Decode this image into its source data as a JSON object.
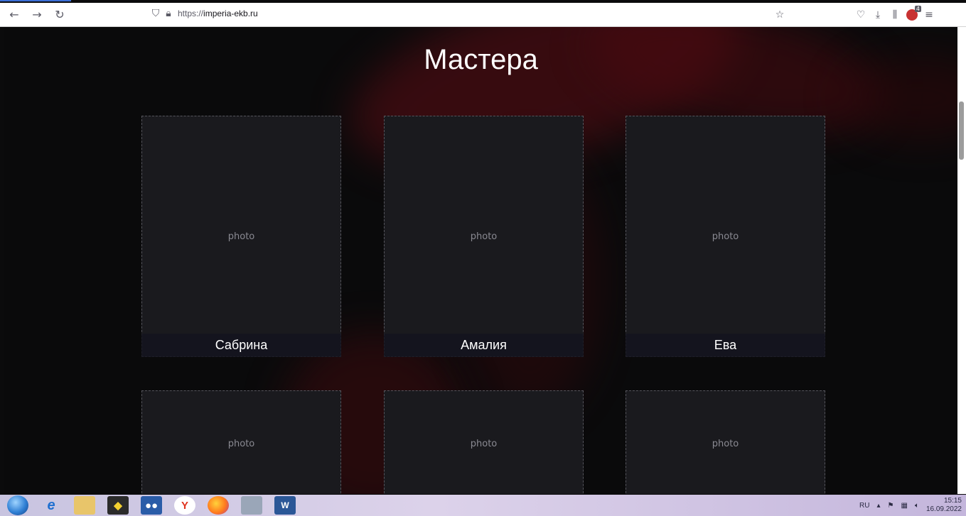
{
  "browser": {
    "url_prefix": "https://",
    "url_domain": "imperia-ekb.ru",
    "icons": [
      "back-icon",
      "forward-icon",
      "reload-icon",
      "shield-icon",
      "lock-icon",
      "bookmark-star-icon",
      "pocket-icon",
      "download-icon",
      "library-icon",
      "extension-icon",
      "menu-icon"
    ],
    "extension_badge": "4"
  },
  "page": {
    "heading": "Мастера",
    "cards": [
      {
        "name": "Сабрина"
      },
      {
        "name": "Амалия"
      },
      {
        "name": "Ева"
      },
      {
        "name": ""
      },
      {
        "name": ""
      },
      {
        "name": ""
      }
    ],
    "placeholder_text": "photo"
  },
  "taskbar": {
    "apps": [
      "start-orb",
      "internet-explorer-icon",
      "file-explorer-icon",
      "batman-app-icon",
      "messenger-app-icon",
      "yandex-browser-icon",
      "firefox-icon",
      "user-app-icon",
      "word-icon"
    ],
    "tray": {
      "language": "RU",
      "time": "15:15",
      "date": "16.09.2022"
    }
  }
}
